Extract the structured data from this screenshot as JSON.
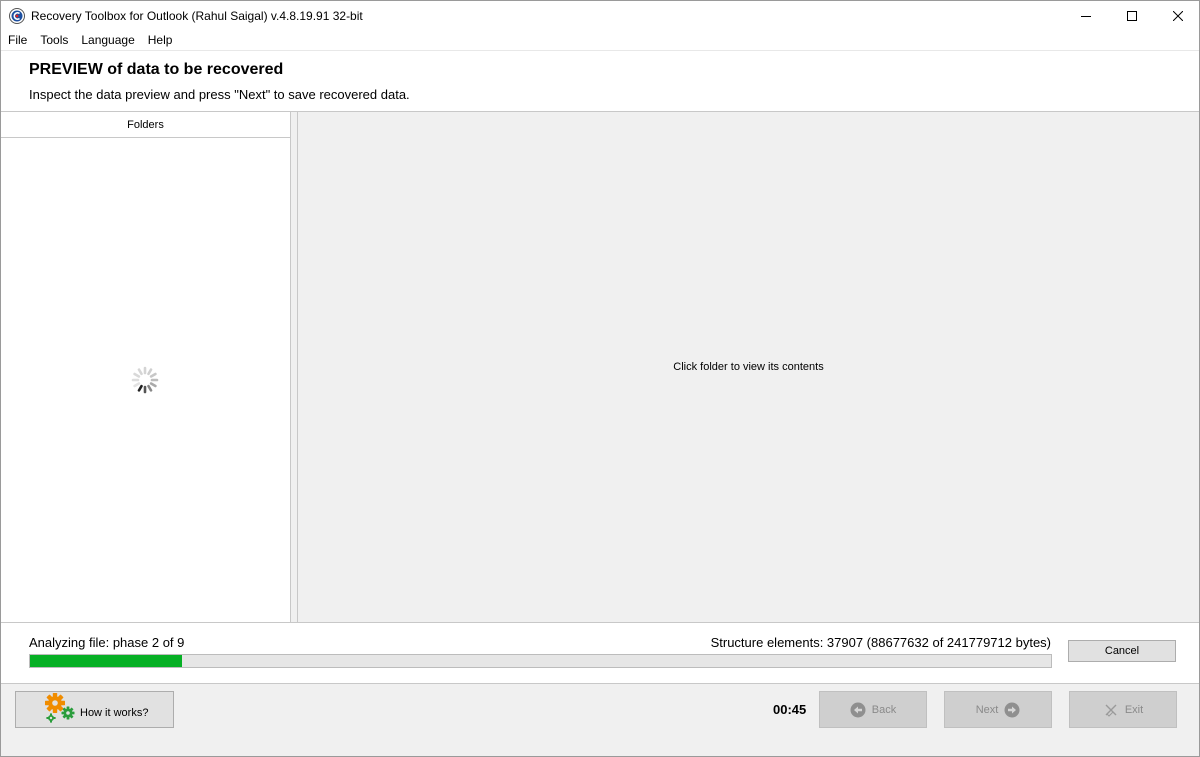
{
  "window": {
    "title": "Recovery Toolbox for Outlook (Rahul Saigal) v.4.8.19.91 32-bit"
  },
  "menu": [
    "File",
    "Tools",
    "Language",
    "Help"
  ],
  "header": {
    "title": "PREVIEW of data to be recovered",
    "subtitle": "Inspect the data preview and press \"Next\" to save recovered data."
  },
  "folders_pane": {
    "header": "Folders"
  },
  "contents_pane": {
    "message": "Click folder to view its contents"
  },
  "progress": {
    "phase_text": "Analyzing file: phase 2 of 9",
    "structure_text": "Structure elements: 37907 (88677632 of 241779712 bytes)",
    "fraction": 0.1488,
    "fill_color": "#06b025",
    "cancel_label": "Cancel"
  },
  "bottom": {
    "how_label": "How it works?",
    "timer": "00:45",
    "back_label": "Back",
    "next_label": "Next",
    "exit_label": "Exit"
  },
  "icons": {
    "app": "recovery-toolbox-icon",
    "minimize": "minimize-icon",
    "maximize": "maximize-icon",
    "close": "close-icon",
    "spinner": "loading-spinner-icon",
    "gears": "gears-icon",
    "back": "arrow-left-circle-icon",
    "next": "arrow-right-circle-icon",
    "exit": "exit-icon"
  }
}
